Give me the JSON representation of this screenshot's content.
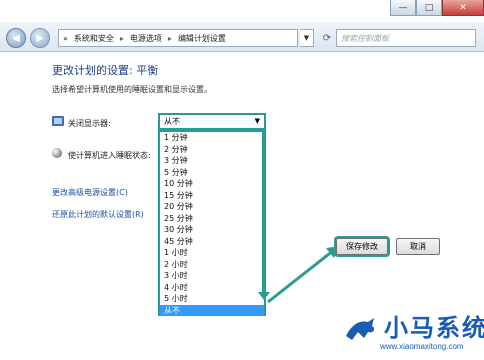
{
  "titlebar": {
    "minimize": "—",
    "maximize": "□",
    "close": "✕"
  },
  "address": {
    "breadcrumb": [
      "«",
      "系统和安全",
      "电源选项",
      "编辑计划设置"
    ],
    "search_placeholder": "搜索控制面板"
  },
  "content": {
    "heading": "更改计划的设置: 平衡",
    "subtext": "选择希望计算机使用的睡眠设置和显示设置。",
    "display_label": "关闭显示器:",
    "sleep_label": "使计算机进入睡眠状态:",
    "advanced_link": "更改高级电源设置(C)",
    "restore_link": "还原此计划的默认设置(R)"
  },
  "display_select": {
    "value": "从不",
    "options": [
      "1 分钟",
      "2 分钟",
      "3 分钟",
      "5 分钟",
      "10 分钟",
      "15 分钟",
      "20 分钟",
      "25 分钟",
      "30 分钟",
      "45 分钟",
      "1 小时",
      "2 小时",
      "3 小时",
      "4 小时",
      "5 小时",
      "从不"
    ],
    "selected_index": 15
  },
  "buttons": {
    "save": "保存修改",
    "cancel": "取消"
  },
  "watermark": {
    "title": "小马系统",
    "url": "www.xiaomaxitong.com"
  },
  "colors": {
    "accent": "#2a9c8f",
    "link": "#1e50a0",
    "heading": "#1e3f86",
    "selection": "#3399ff"
  }
}
